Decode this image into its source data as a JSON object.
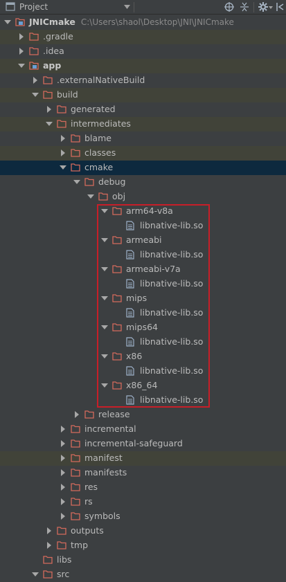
{
  "toolbar": {
    "view_label": "Project"
  },
  "tree": [
    {
      "label": "JNICmake",
      "path": "C:\\Users\\shaol\\Desktop\\JNI\\JNICmake",
      "depth": 0,
      "arrow": "down",
      "icon": "module-folder",
      "bold": true
    },
    {
      "label": ".gradle",
      "depth": 1,
      "arrow": "right",
      "icon": "folder"
    },
    {
      "label": ".idea",
      "depth": 1,
      "arrow": "right",
      "icon": "folder"
    },
    {
      "label": "app",
      "depth": 1,
      "arrow": "down",
      "icon": "module-folder",
      "bold": true
    },
    {
      "label": ".externalNativeBuild",
      "depth": 2,
      "arrow": "right",
      "icon": "folder"
    },
    {
      "label": "build",
      "depth": 2,
      "arrow": "down",
      "icon": "folder"
    },
    {
      "label": "generated",
      "depth": 3,
      "arrow": "right",
      "icon": "folder"
    },
    {
      "label": "intermediates",
      "depth": 3,
      "arrow": "down",
      "icon": "folder"
    },
    {
      "label": "blame",
      "depth": 4,
      "arrow": "right",
      "icon": "folder"
    },
    {
      "label": "classes",
      "depth": 4,
      "arrow": "right",
      "icon": "folder"
    },
    {
      "label": "cmake",
      "depth": 4,
      "arrow": "down",
      "icon": "folder",
      "selected": true
    },
    {
      "label": "debug",
      "depth": 5,
      "arrow": "down",
      "icon": "folder"
    },
    {
      "label": "obj",
      "depth": 6,
      "arrow": "down",
      "icon": "folder"
    },
    {
      "label": "arm64-v8a",
      "depth": 7,
      "arrow": "down",
      "icon": "folder"
    },
    {
      "label": "libnative-lib.so",
      "depth": 8,
      "arrow": "none",
      "icon": "file"
    },
    {
      "label": "armeabi",
      "depth": 7,
      "arrow": "down",
      "icon": "folder"
    },
    {
      "label": "libnative-lib.so",
      "depth": 8,
      "arrow": "none",
      "icon": "file"
    },
    {
      "label": "armeabi-v7a",
      "depth": 7,
      "arrow": "down",
      "icon": "folder"
    },
    {
      "label": "libnative-lib.so",
      "depth": 8,
      "arrow": "none",
      "icon": "file"
    },
    {
      "label": "mips",
      "depth": 7,
      "arrow": "down",
      "icon": "folder"
    },
    {
      "label": "libnative-lib.so",
      "depth": 8,
      "arrow": "none",
      "icon": "file"
    },
    {
      "label": "mips64",
      "depth": 7,
      "arrow": "down",
      "icon": "folder"
    },
    {
      "label": "libnative-lib.so",
      "depth": 8,
      "arrow": "none",
      "icon": "file"
    },
    {
      "label": "x86",
      "depth": 7,
      "arrow": "down",
      "icon": "folder"
    },
    {
      "label": "libnative-lib.so",
      "depth": 8,
      "arrow": "none",
      "icon": "file"
    },
    {
      "label": "x86_64",
      "depth": 7,
      "arrow": "down",
      "icon": "folder"
    },
    {
      "label": "libnative-lib.so",
      "depth": 8,
      "arrow": "none",
      "icon": "file"
    },
    {
      "label": "release",
      "depth": 5,
      "arrow": "right",
      "icon": "folder"
    },
    {
      "label": "incremental",
      "depth": 4,
      "arrow": "right",
      "icon": "folder"
    },
    {
      "label": "incremental-safeguard",
      "depth": 4,
      "arrow": "right",
      "icon": "folder"
    },
    {
      "label": "manifest",
      "depth": 4,
      "arrow": "right",
      "icon": "folder"
    },
    {
      "label": "manifests",
      "depth": 4,
      "arrow": "right",
      "icon": "folder"
    },
    {
      "label": "res",
      "depth": 4,
      "arrow": "right",
      "icon": "folder"
    },
    {
      "label": "rs",
      "depth": 4,
      "arrow": "right",
      "icon": "folder"
    },
    {
      "label": "symbols",
      "depth": 4,
      "arrow": "right",
      "icon": "folder"
    },
    {
      "label": "outputs",
      "depth": 3,
      "arrow": "right",
      "icon": "folder"
    },
    {
      "label": "tmp",
      "depth": 3,
      "arrow": "right",
      "icon": "folder"
    },
    {
      "label": "libs",
      "depth": 2,
      "arrow": "none",
      "icon": "folder"
    },
    {
      "label": "src",
      "depth": 2,
      "arrow": "down",
      "icon": "folder"
    }
  ],
  "colors": {
    "background": "#3c3f41",
    "selected": "#0d293e",
    "folder": "#d46a5c",
    "file": "#9db0c8",
    "highlight": "#c81e28"
  }
}
